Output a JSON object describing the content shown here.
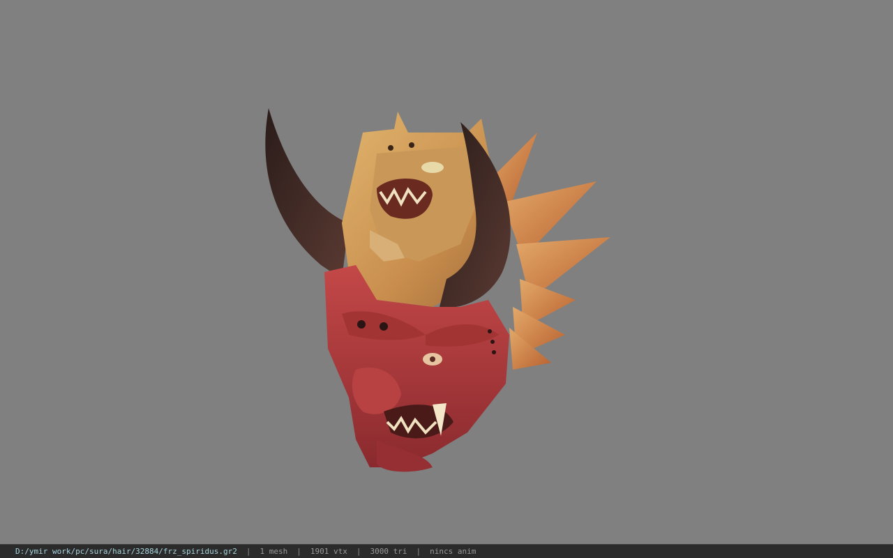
{
  "viewport": {
    "background_color": "#808080",
    "model_icon": "demon-oni-mask-icon"
  },
  "statusbar": {
    "file_path": "D:/ymir work/pc/sura/hair/32884/frz_spiridus.gr2",
    "separator": "|",
    "mesh_count": "1 mesh",
    "vertex_count": "1901 vtx",
    "triangle_count": "3000 tri",
    "anim_status": "nincs anim"
  },
  "colors": {
    "statusbar_bg": "#2b2b2b",
    "path_text": "#a9d6df",
    "stat_text": "#9a9a9a",
    "mask_red": "#b23a3a",
    "mask_gold": "#d4a35a",
    "horn_dark": "#3a2a28"
  }
}
